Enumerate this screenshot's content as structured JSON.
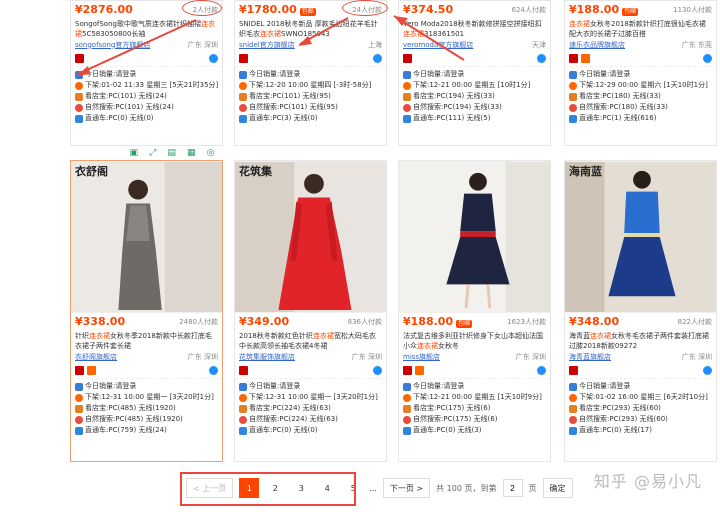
{
  "row1": [
    {
      "price": "¥2876.00",
      "tag": "",
      "paid": "2人付款",
      "title_a": "SongofSong歌中歌气质连衣裙针织抽褶",
      "title_em": "连衣裙",
      "title_b": "5C583050800长袖",
      "shop": "songofsong官方旗舰店",
      "loc": "广东 深圳",
      "sales": "今日销量:请登录",
      "time": "下架:01-02 11:33 星期三 [5天21时35分]",
      "view": "看店宝:PC(101) 无线(24)",
      "search": "自然搜索:PC(101) 无线(24)",
      "car": "直通车:PC(0) 无线(0)"
    },
    {
      "price": "¥1780.00",
      "tag": "包邮",
      "paid": "24人付款",
      "title_a": "SNIDEL 2018秋冬新品 厚款毛边纽花羊毛针织毛衣",
      "title_em": "连衣裙",
      "title_b": "SWNO185043",
      "shop": "snidel官方旗舰店",
      "loc": "上海",
      "sales": "今日销量:请登录",
      "time": "下架:12-20 10:00 星期四 [-3时-58分]",
      "view": "看店宝:PC(101) 无线(95)",
      "search": "自然搜索:PC(101) 无线(95)",
      "car": "直通车:PC(3) 无线(0)"
    },
    {
      "price": "¥374.50",
      "tag": "",
      "paid": "624人付款",
      "title_a": "Vero Moda2018秋冬新款修拼接空拼接纽扣",
      "title_em": "连衣裙",
      "title_b": "318361501",
      "shop": "veromoda官方旗舰店",
      "loc": "天津",
      "sales": "今日销量:请登录",
      "time": "下架:12-21 00:00 星期五 [10时1分]",
      "view": "看店宝:PC(194) 无线(33)",
      "search": "自然搜索:PC(194) 无线(33)",
      "car": "直通车:PC(111) 无线(5)"
    },
    {
      "price": "¥188.00",
      "tag": "包邮",
      "paid": "1130人付款",
      "title_a": "",
      "title_em": "连衣裙",
      "title_b": "女秋冬2018新款针织打底很仙毛衣裙配大衣的长裙子过膝百搭",
      "shop": "速乐衣品牌旗舰店",
      "loc": "广东 东莞",
      "sales": "今日销量:请登录",
      "time": "下架:12-29 00:00 星期六 [1天10时1分]",
      "view": "看店宝:PC(180) 无线(33)",
      "search": "自然搜索:PC(180) 无线(33)",
      "car": "直通车:PC(1) 无线(616)"
    }
  ],
  "row2": [
    {
      "brand": "衣舒阁",
      "price": "¥338.00",
      "tag": "",
      "paid": "2480人付款",
      "title_a": "针织",
      "title_em": "连衣裙",
      "title_b": "女秋冬季2018新款中长款打底毛衣裙子两件套长裙",
      "shop": "衣舒阁旗舰店",
      "loc": "广东 深圳",
      "sales": "今日销量:请登录",
      "time": "下架:12-31 10:00 星期一 [3天20时1分]",
      "view": "看店宝:PC(485) 无线(1920)",
      "search": "自然搜索:PC(485) 无线(1920)",
      "car": "直通车:PC(759) 无线(24)"
    },
    {
      "brand": "花筑集",
      "price": "¥349.00",
      "tag": "",
      "paid": "836人付款",
      "title_a": "2018秋冬新款红色针织",
      "title_em": "连衣裙",
      "title_b": "宽松大码毛衣中长款高领长袖毛衣裙4冬裙",
      "shop": "花筑集服饰旗舰店",
      "loc": "广东 深圳",
      "sales": "今日销量:请登录",
      "time": "下架:12-31 10:00 星期一 [3天20时1分]",
      "view": "看店宝:PC(224) 无线(63)",
      "search": "自然搜索:PC(224) 无线(63)",
      "car": "直通车:PC(0) 无线(0)"
    },
    {
      "brand": "",
      "price": "¥188.00",
      "tag": "包邮",
      "paid": "1623人付款",
      "title_a": "法式复古维多利亚针织修身下女山本超仙法国小众",
      "title_em": "连衣裙",
      "title_b": "女秋冬",
      "shop": "miss旗舰店",
      "loc": "广东 深圳",
      "sales": "今日销量:请登录",
      "time": "下架:12-21 00:00 星期五 [1天10时9分]",
      "view": "看店宝:PC(175) 无线(6)",
      "search": "自然搜索:PC(175) 无线(6)",
      "car": "直通车:PC(0) 无线(3)"
    },
    {
      "brand": "海南蓝",
      "price": "¥348.00",
      "tag": "",
      "paid": "822人付款",
      "title_a": "海青蓝",
      "title_em": "连衣裙",
      "title_b": "女秋冬毛衣裙子两件套装打底裙过膝2018新款09272",
      "shop": "海青蓝旗舰店",
      "loc": "广东 深圳",
      "sales": "今日销量:请登录",
      "time": "下架:01-02 16:00 星期三 [6天2时10分]",
      "view": "看店宝:PC(293) 无线(60)",
      "search": "自然搜索:PC(293) 无线(60)",
      "car": "直通车:PC(0) 无线(17)"
    }
  ],
  "toolbar": [
    "▣",
    "⤢",
    "▤",
    "▦",
    "◎"
  ],
  "pager": {
    "prev": "< 上一页",
    "pages": [
      "1",
      "2",
      "3",
      "4",
      "5"
    ],
    "ellipsis": "...",
    "next": "下一页 >",
    "total": "共 100 页，到第",
    "page_value": "2",
    "unit": "页",
    "confirm": "确定"
  },
  "watermark": "知乎 @易小凡",
  "colors": {
    "accent": "#ff4400",
    "link": "#3366cc",
    "annotation": "#e8493a"
  }
}
